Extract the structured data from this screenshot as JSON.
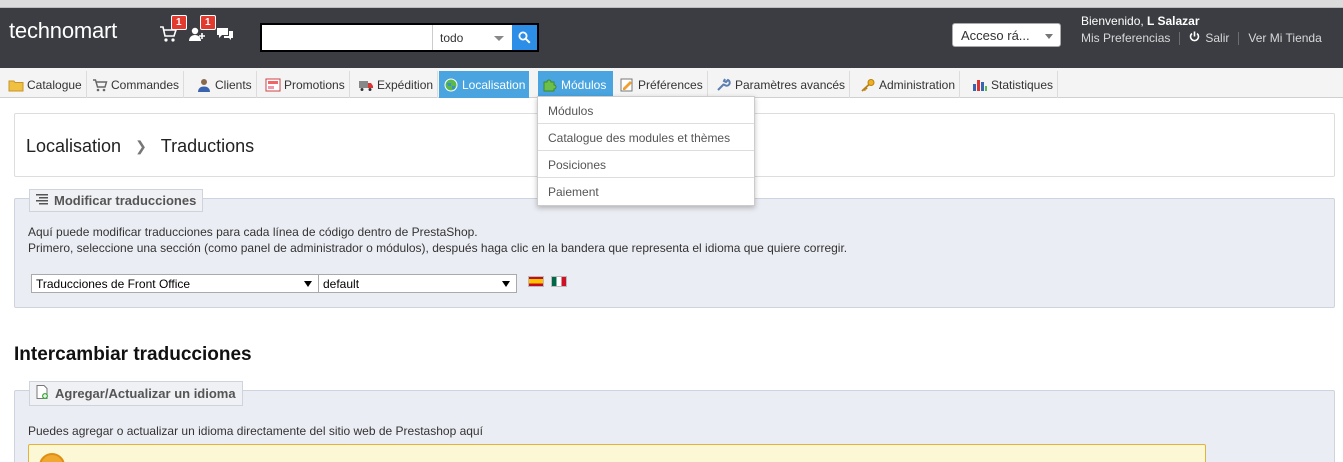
{
  "header": {
    "brand": "technomart",
    "cart_badge": "1",
    "customers_badge": "1",
    "search": {
      "value": "",
      "scope": "todo"
    },
    "quick_access": "Acceso rá...",
    "welcome_prefix": "Bienvenido, ",
    "welcome_name": "L Salazar",
    "preferences_link": "Mis Preferencias",
    "logout_link": "Salir",
    "store_link": "Ver Mi Tienda",
    "colors": {
      "topbar": "#3b3d42",
      "accent": "#49a4e0",
      "badge": "#e23a2e"
    }
  },
  "menu": {
    "items": [
      {
        "label": "Catalogue",
        "icon": "folder-icon"
      },
      {
        "label": "Commandes",
        "icon": "cart-icon"
      },
      {
        "label": "Clients",
        "icon": "user-icon"
      },
      {
        "label": "Promotions",
        "icon": "promotion-icon"
      },
      {
        "label": "Expédition",
        "icon": "truck-icon"
      },
      {
        "label": "Localisation",
        "icon": "globe-icon",
        "active": true
      },
      {
        "label": "Módulos",
        "icon": "puzzle-icon",
        "active": true
      },
      {
        "label": "Préférences",
        "icon": "preferences-icon"
      },
      {
        "label": "Paramètres avancés",
        "icon": "wrench-icon"
      },
      {
        "label": "Administration",
        "icon": "key-icon"
      },
      {
        "label": "Statistiques",
        "icon": "stats-icon"
      }
    ],
    "dropdown": [
      "Módulos",
      "Catalogue des modules et thèmes",
      "Posiciones",
      "Paiement"
    ]
  },
  "breadcrumb": {
    "parent": "Localisation",
    "current": "Traductions"
  },
  "modify": {
    "legend": "Modificar traducciones",
    "line1": "Aquí puede modificar traducciones para cada línea de código dentro de PrestaShop.",
    "line2": "Primero, seleccione una sección (como panel de administrador o módulos), después haga clic en la bandera que representa el idioma que quiere corregir.",
    "type_select": "Traducciones de Front Office",
    "theme_select": "default"
  },
  "exchange": {
    "title": "Intercambiar traducciones",
    "legend": "Agregar/Actualizar un idioma",
    "text": "Puedes agregar o actualizar un idioma directamente del sitio web de Prestashop aquí"
  }
}
